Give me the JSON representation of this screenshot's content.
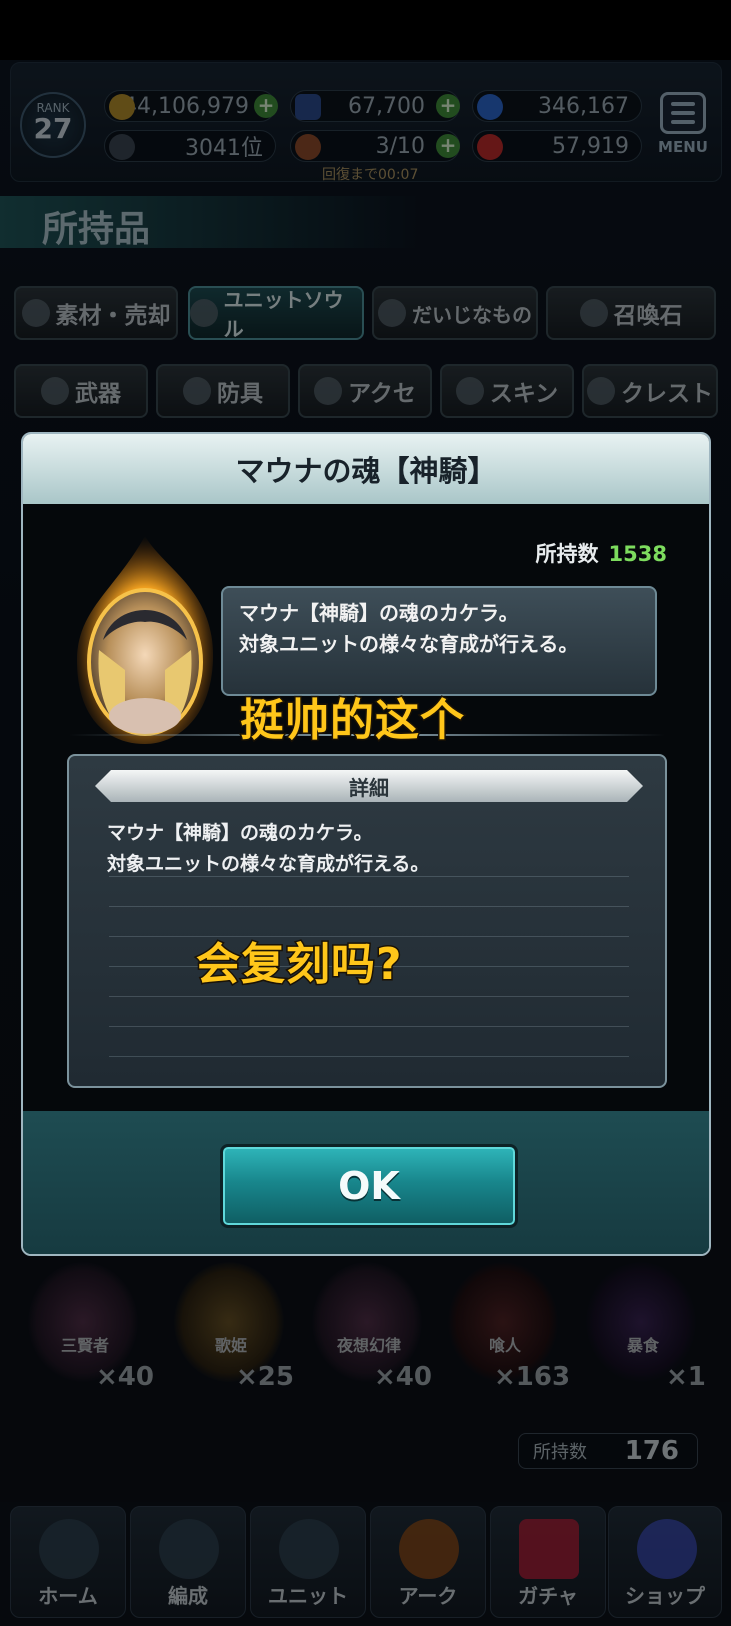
{
  "header": {
    "rank_label": "RANK",
    "rank_value": "27",
    "gold": "44,106,979",
    "crystals": "67,700",
    "orbs": "346,167",
    "ranking": "3041位",
    "stamina": "3/10",
    "red_stones": "57,919",
    "recover_timer": "回復まで00:07",
    "menu_label": "MENU"
  },
  "section_title": "所持品",
  "tabs_row1": [
    "素材・売却",
    "ユニットソウル",
    "だいじなもの",
    "召喚石"
  ],
  "tabs_row2": [
    "武器",
    "防具",
    "アクセ",
    "スキン",
    "クレスト"
  ],
  "background_items": [
    {
      "name": "三賢者",
      "count": "×40"
    },
    {
      "name": "歌姫",
      "count": "×25"
    },
    {
      "name": "夜想幻律",
      "count": "×40"
    },
    {
      "name": "喰人",
      "count": "×163"
    },
    {
      "name": "暴食",
      "count": "×1"
    }
  ],
  "owned_panel": {
    "label": "所持数",
    "value": "176"
  },
  "bottom_nav": [
    "ホーム",
    "編成",
    "ユニット",
    "アーク",
    "ガチャ",
    "ショップ"
  ],
  "modal": {
    "title": "マウナの魂【神騎】",
    "owned_label": "所持数",
    "owned_value": "1538",
    "desc_line1": "マウナ【神騎】の魂のカケラ。",
    "desc_line2": "対象ユニットの様々な育成が行える。",
    "detail_header": "詳細",
    "detail_line1": "マウナ【神騎】の魂のカケラ。",
    "detail_line2": "対象ユニットの様々な育成が行える。",
    "ok_label": "OK"
  },
  "captions": {
    "line1": "挺帅的这个",
    "line2": "会复刻吗?"
  },
  "colors": {
    "owned_count": "#7ddc5e",
    "caption": "#ffc61a",
    "ok_button": "#18868c"
  }
}
